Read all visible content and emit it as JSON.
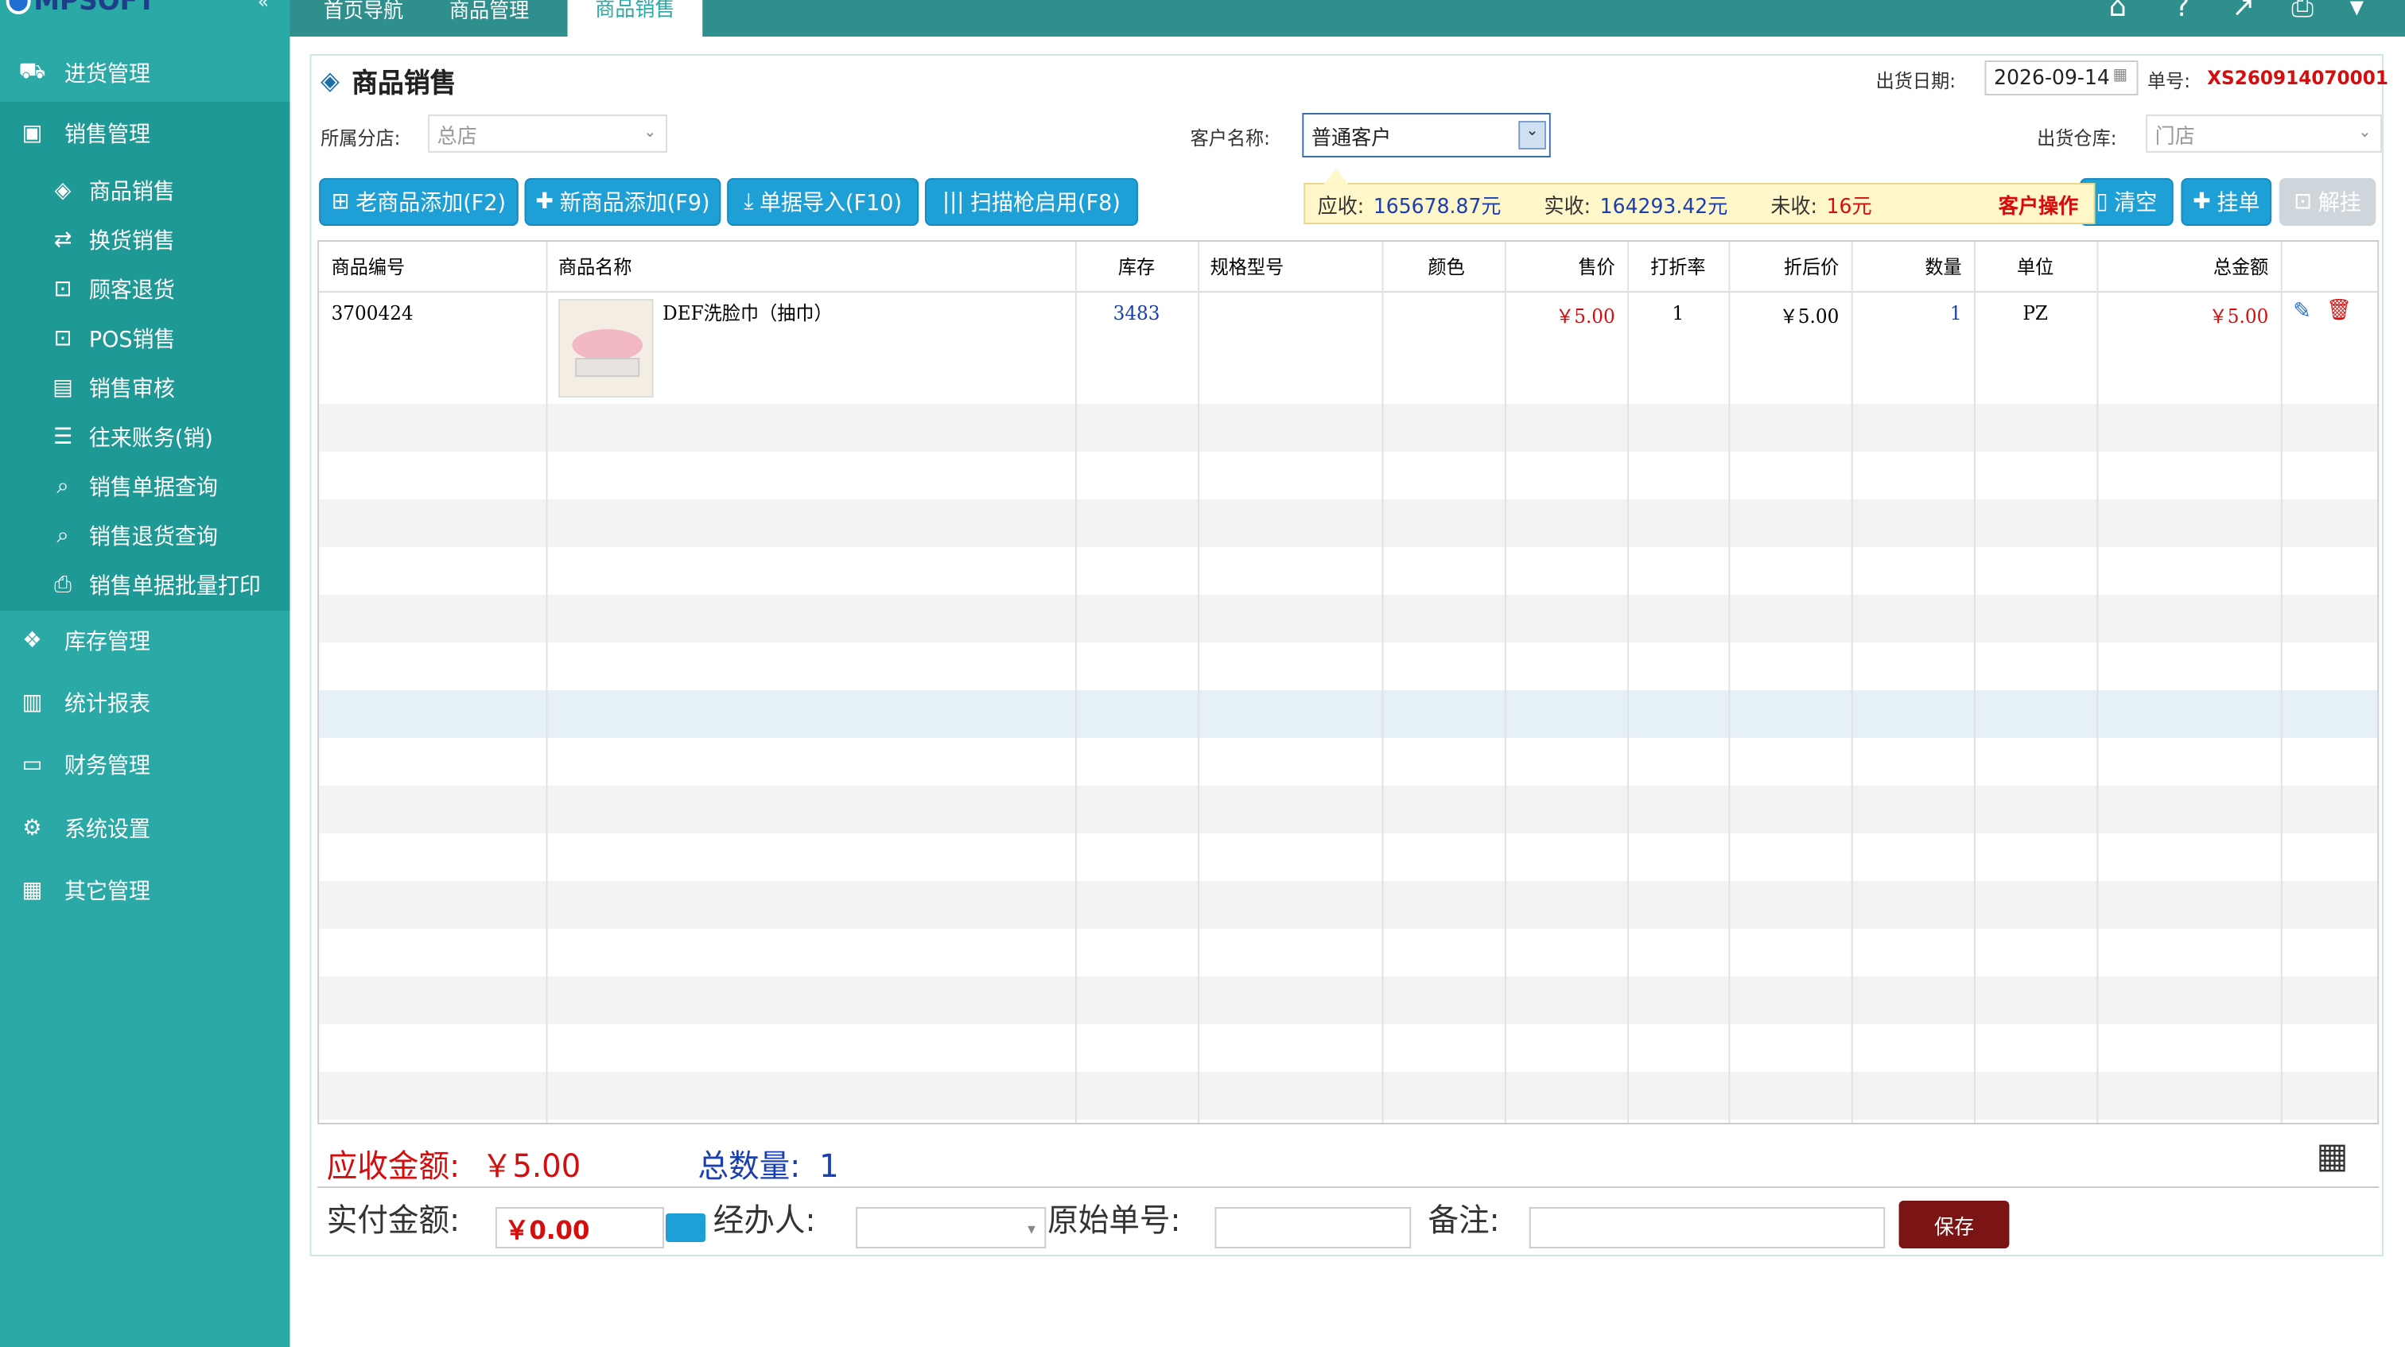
{
  "app": {
    "logo": "MPSOFT"
  },
  "colors": {
    "sidebar": "#2aa9a7",
    "accent": "#1e9fd6",
    "red": "#d50d0d",
    "blue": "#1a3fb0"
  },
  "topbar": {
    "tabs": [
      "首页导航",
      "商品管理",
      "商品销售"
    ],
    "icons": [
      "store-icon",
      "help-icon",
      "export-icon",
      "print-icon",
      "chevron-down-icon"
    ]
  },
  "sidebar": {
    "top_item": "进货管理",
    "sales_head": "销售管理",
    "sales_items": [
      "商品销售",
      "换货销售",
      "顾客退货",
      "POS销售",
      "销售审核",
      "往来账务(销)",
      "销售单据查询",
      "销售退货查询",
      "销售单据批量打印"
    ],
    "other_items": [
      "库存管理",
      "统计报表",
      "财务管理",
      "系统设置",
      "其它管理"
    ]
  },
  "page": {
    "title": "商品销售",
    "ship_date_label": "出货日期:",
    "ship_date": "2026-09-14",
    "order_no_label": "单号:",
    "order_no": "XS260914070001",
    "branch_label": "所属分店:",
    "branch_value": "总店",
    "customer_label": "客户名称:",
    "customer_value": "普通客户",
    "warehouse_label": "出货仓库:",
    "warehouse_value": "门店"
  },
  "buttons": {
    "old_add": "老商品添加(F2)",
    "new_add": "新商品添加(F9)",
    "import": "单据导入(F10)",
    "scan": "扫描枪启用(F8)",
    "clear": "清空",
    "hold": "挂单",
    "unhold": "解挂",
    "save": "保存"
  },
  "info": {
    "receivable_label": "应收:",
    "receivable": "165678.87元",
    "received_label": "实收:",
    "received": "164293.42元",
    "outstanding_label": "未收:",
    "outstanding": "16元",
    "op": "客户操作"
  },
  "table": {
    "columns": [
      "商品编号",
      "商品名称",
      "库存",
      "规格型号",
      "颜色",
      "售价",
      "打折率",
      "折后价",
      "数量",
      "单位",
      "总金额"
    ],
    "rows": [
      {
        "code": "3700424",
        "name": "DEF洗脸巾（抽巾）",
        "stock": "3483",
        "spec": "",
        "color": "",
        "price": "￥5.00",
        "discount": "1",
        "net": "￥5.00",
        "qty": "1",
        "unit": "PZ",
        "total": "￥5.00"
      }
    ]
  },
  "summary": {
    "due_label": "应收金额:",
    "due_value": "￥5.00",
    "count_label": "总数量:",
    "count_value": "1",
    "paid_label": "实付金额:",
    "paid_value": "￥0.00",
    "handler_label": "经办人:",
    "orig_label": "原始单号:",
    "note_label": "备注:"
  }
}
